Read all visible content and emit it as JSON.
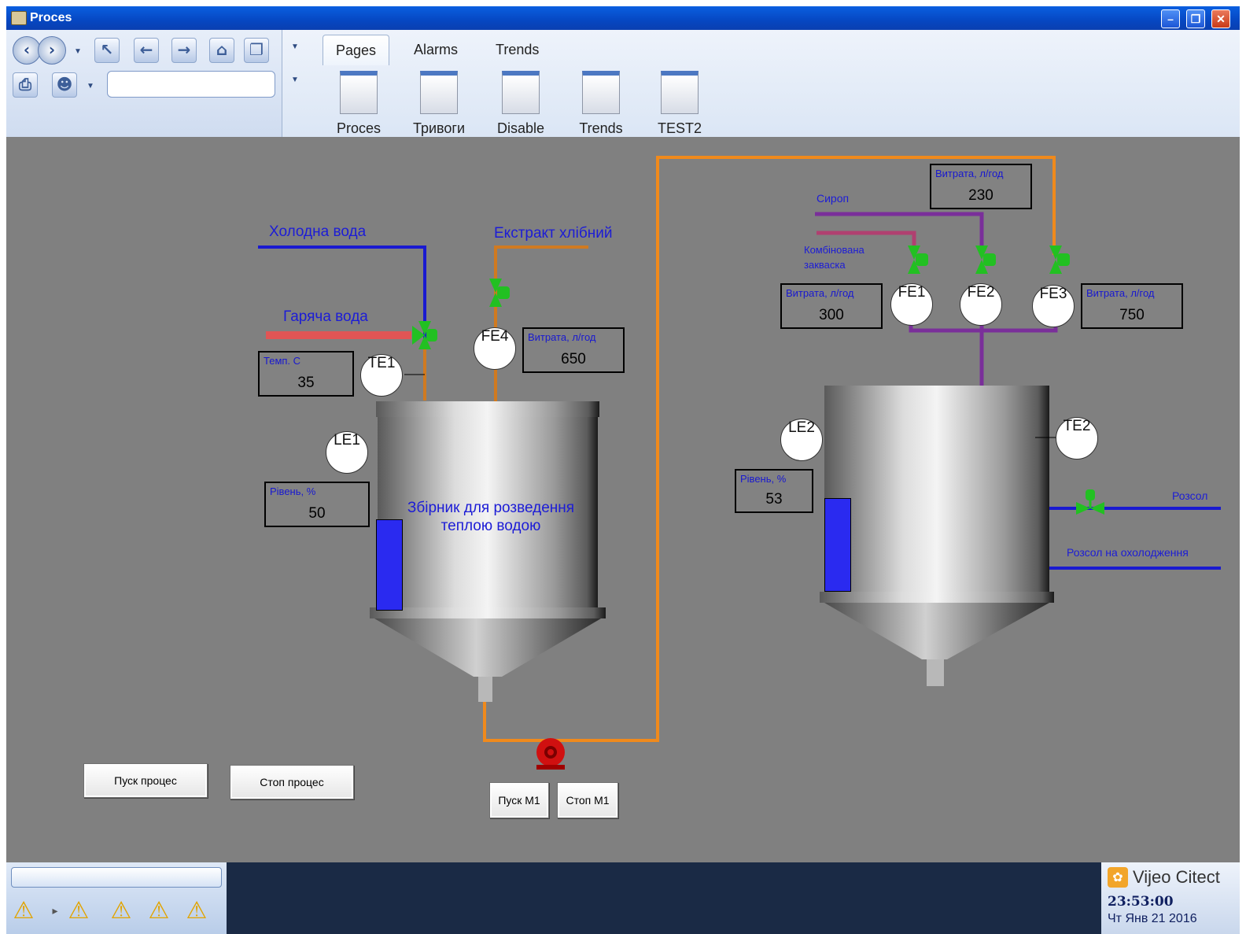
{
  "window": {
    "title": "Proces",
    "minimize": "–",
    "restore": "❐",
    "close": "✕"
  },
  "toolbar": {
    "tabs": [
      "Pages",
      "Alarms",
      "Trends"
    ],
    "pages": [
      "Proces",
      "Тривоги",
      "Disable",
      "Trends",
      "TEST2"
    ],
    "address_value": ""
  },
  "process": {
    "cold_water": "Холодна вода",
    "hot_water": "Гаряча вода",
    "bread_extract": "Екстракт хлібний",
    "syrup": "Сироп",
    "combined_starter": "Комбінована закваска",
    "brine": "Розсол",
    "brine_cooling": "Розсол на охолодження",
    "tank1_label": "Збірник для розведення теплою водою",
    "temp_box": {
      "caption": "Темп. С",
      "value": "35"
    },
    "level1_box": {
      "caption": "Рівень, %",
      "value": "50"
    },
    "fe4_box": {
      "caption": "Витрата, л/год",
      "value": "650"
    },
    "fe1_box": {
      "caption": "Витрата, л/год",
      "value": "300"
    },
    "fe2_box": {
      "caption": "Витрата, л/год",
      "value": "230"
    },
    "fe3_box": {
      "caption": "Витрата, л/год",
      "value": "750"
    },
    "level2_box": {
      "caption": "Рівень, %",
      "value": "53"
    },
    "instruments": {
      "te1": "TE1",
      "fe4": "FE4",
      "le1": "LE1",
      "fe1": "FE1",
      "fe2": "FE2",
      "fe3": "FE3",
      "le2": "LE2",
      "te2": "TE2"
    },
    "level1_fraction": 0.5,
    "level2_fraction": 0.53
  },
  "buttons": {
    "start_process": "Пуск процес",
    "stop_process": "Стоп процес",
    "start_m1": "Пуск М1",
    "stop_m1": "Стоп М1"
  },
  "statusbar": {
    "brand": "Vijeo Citect",
    "time": "23:53:00",
    "date": "Чт Янв 21 2016"
  },
  "colors": {
    "cold_water": "#1a1ad0",
    "hot_water": "#e05555",
    "extract_pipe": "#d07a20",
    "product_pipe": "#f08a1c",
    "syrup": "#7a2f9a",
    "valve": "#22c022",
    "level_fill": "#2a2af0",
    "canvas": "#808080"
  }
}
